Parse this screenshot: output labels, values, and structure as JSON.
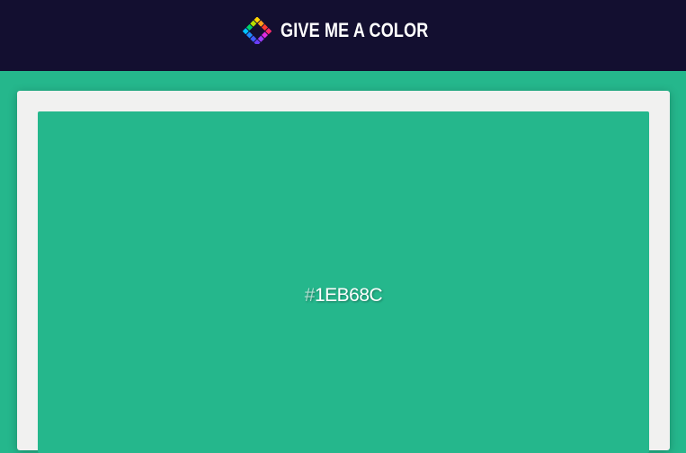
{
  "header": {
    "title": "GIVE ME A COLOR",
    "logo_icon": "diamond-logo-icon"
  },
  "color": {
    "hash": "#",
    "hex": "1EB68C",
    "value": "#25b78c"
  },
  "theme": {
    "header_bg": "#130f30",
    "page_bg": "#25b78c",
    "card_bg": "#f1f1f0"
  }
}
